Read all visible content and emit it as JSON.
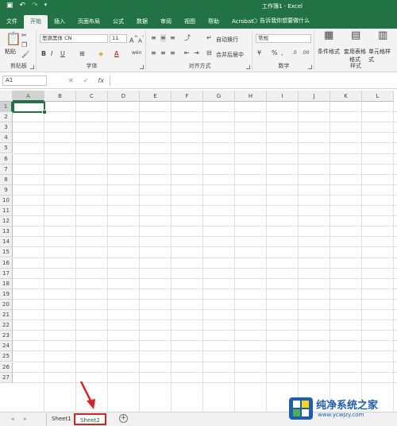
{
  "qat": {
    "save_icon": "save-icon",
    "undo_icon": "undo-icon",
    "redo_icon": "redo-icon",
    "customize_icon": "chevron-down-icon"
  },
  "window": {
    "title": "工作簿1  -  Excel"
  },
  "tabs": [
    {
      "label": "文件"
    },
    {
      "label": "开始"
    },
    {
      "label": "插入"
    },
    {
      "label": "页面布局"
    },
    {
      "label": "公式"
    },
    {
      "label": "数据"
    },
    {
      "label": "审阅"
    },
    {
      "label": "视图"
    },
    {
      "label": "帮助"
    },
    {
      "label": "Acrobat"
    }
  ],
  "tellme": {
    "label": "告诉我你想要做什么"
  },
  "ribbon": {
    "clipboard": {
      "paste": "粘贴",
      "group": "剪贴板"
    },
    "font": {
      "name": "思源黑体 CN",
      "size": "11",
      "bold": "B",
      "italic": "I",
      "underline": "U",
      "grow": "A",
      "shrink": "A",
      "group": "字体",
      "wen": "wén"
    },
    "align": {
      "wrap": "自动换行",
      "merge": "合并后居中",
      "group": "对齐方式"
    },
    "number": {
      "format": "常规",
      "group": "数字",
      "percent": "%",
      "comma": ","
    },
    "styles": {
      "cond": "条件格式",
      "table": "套用表格格式",
      "cell": "单元格样式",
      "group": "样式"
    }
  },
  "formula_bar": {
    "name_box": "A1",
    "fx": "fx"
  },
  "columns": [
    "A",
    "B",
    "C",
    "D",
    "E",
    "F",
    "G",
    "H",
    "I",
    "J",
    "K",
    "L"
  ],
  "rows": [
    "1",
    "2",
    "3",
    "4",
    "5",
    "6",
    "7",
    "8",
    "9",
    "10",
    "11",
    "12",
    "13",
    "14",
    "15",
    "16",
    "17",
    "18",
    "19",
    "20",
    "21",
    "22",
    "23",
    "24",
    "25",
    "26",
    "27"
  ],
  "sheets": [
    {
      "label": "Sheet1"
    },
    {
      "label": "Sheet2"
    }
  ],
  "watermark": {
    "title": "纯净系统之家",
    "url": "www.ycwjzy.com"
  },
  "colors": {
    "excel_green": "#217346",
    "highlight_red": "#e02020",
    "watermark_blue": "#1a5fb4"
  }
}
